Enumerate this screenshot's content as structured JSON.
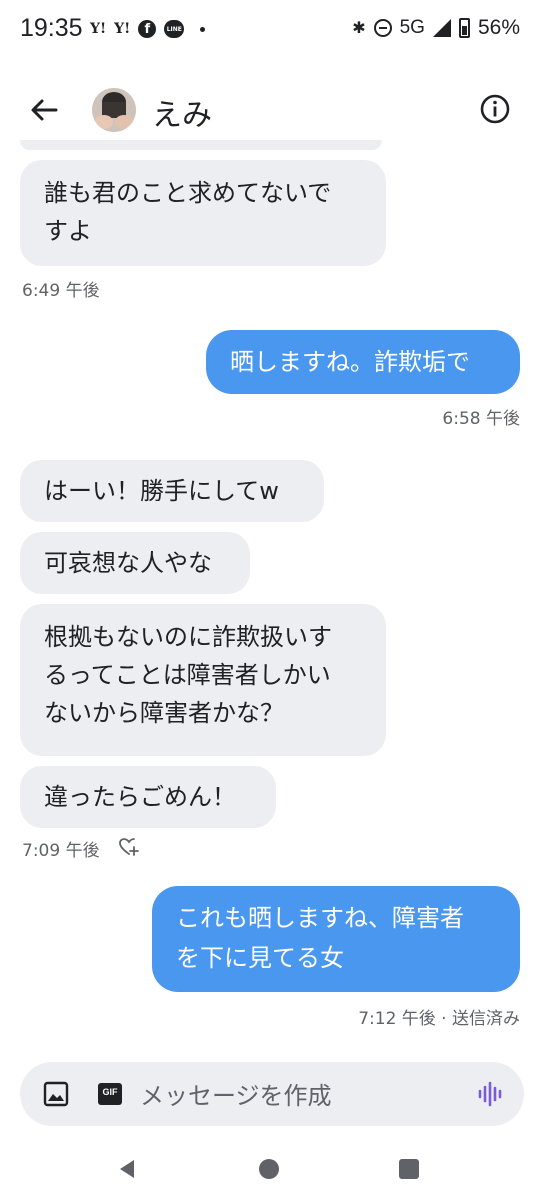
{
  "status_bar": {
    "time": "19:35",
    "yahoo1": "Y!",
    "yahoo2": "Y!",
    "fb": "f",
    "line": "LINE",
    "network": "5G",
    "battery": "56%"
  },
  "header": {
    "contact_name": "えみ"
  },
  "messages": [
    {
      "dir": "in",
      "lines": [
        "誰も君のこと求めてないで",
        "すよ"
      ]
    },
    {
      "dir": "out",
      "lines": [
        "晒しますね。詐欺垢で"
      ]
    },
    {
      "dir": "in",
      "lines": [
        "はーい！勝手にしてw"
      ]
    },
    {
      "dir": "in",
      "lines": [
        "可哀想な人やな"
      ]
    },
    {
      "dir": "in",
      "lines": [
        "根拠もないのに詐欺扱いす",
        "るってことは障害者しかい",
        "ないから障害者かな？"
      ]
    },
    {
      "dir": "in",
      "lines": [
        "違ったらごめん！"
      ]
    },
    {
      "dir": "out",
      "lines": [
        "これも晒しますね、障害者",
        "を下に見てる女"
      ]
    }
  ],
  "timestamps": {
    "t1": "6:49 午後",
    "t2": "6:58 午後",
    "t3": "7:09 午後",
    "t4": "7:12 午後 · 送信済み"
  },
  "composer": {
    "placeholder": "メッセージを作成",
    "gif_label": "GIF"
  },
  "colors": {
    "outgoing_bubble": "#4a97f0",
    "incoming_bubble": "#eceef2",
    "voice_icon": "#7c5cd6"
  }
}
